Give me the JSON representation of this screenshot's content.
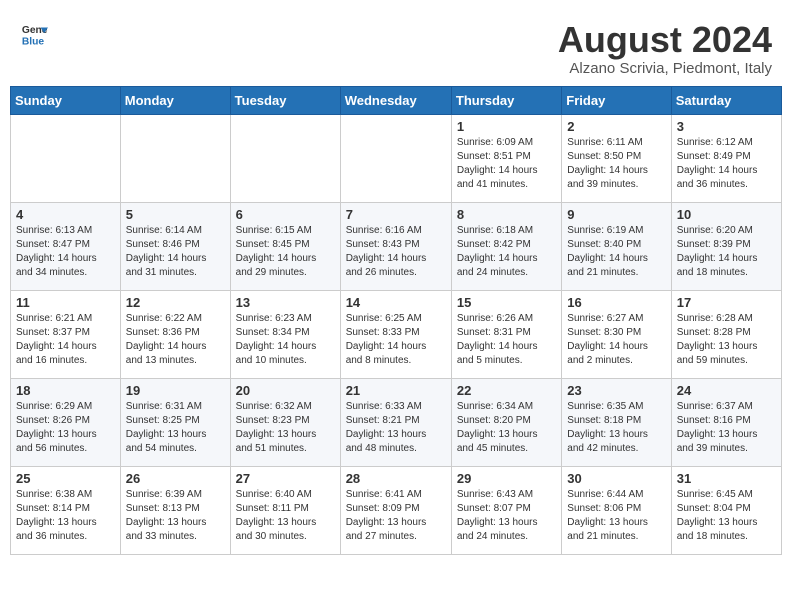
{
  "header": {
    "logo_general": "General",
    "logo_blue": "Blue",
    "month_year": "August 2024",
    "location": "Alzano Scrivia, Piedmont, Italy"
  },
  "weekdays": [
    "Sunday",
    "Monday",
    "Tuesday",
    "Wednesday",
    "Thursday",
    "Friday",
    "Saturday"
  ],
  "weeks": [
    [
      {
        "day": "",
        "info": ""
      },
      {
        "day": "",
        "info": ""
      },
      {
        "day": "",
        "info": ""
      },
      {
        "day": "",
        "info": ""
      },
      {
        "day": "1",
        "info": "Sunrise: 6:09 AM\nSunset: 8:51 PM\nDaylight: 14 hours\nand 41 minutes."
      },
      {
        "day": "2",
        "info": "Sunrise: 6:11 AM\nSunset: 8:50 PM\nDaylight: 14 hours\nand 39 minutes."
      },
      {
        "day": "3",
        "info": "Sunrise: 6:12 AM\nSunset: 8:49 PM\nDaylight: 14 hours\nand 36 minutes."
      }
    ],
    [
      {
        "day": "4",
        "info": "Sunrise: 6:13 AM\nSunset: 8:47 PM\nDaylight: 14 hours\nand 34 minutes."
      },
      {
        "day": "5",
        "info": "Sunrise: 6:14 AM\nSunset: 8:46 PM\nDaylight: 14 hours\nand 31 minutes."
      },
      {
        "day": "6",
        "info": "Sunrise: 6:15 AM\nSunset: 8:45 PM\nDaylight: 14 hours\nand 29 minutes."
      },
      {
        "day": "7",
        "info": "Sunrise: 6:16 AM\nSunset: 8:43 PM\nDaylight: 14 hours\nand 26 minutes."
      },
      {
        "day": "8",
        "info": "Sunrise: 6:18 AM\nSunset: 8:42 PM\nDaylight: 14 hours\nand 24 minutes."
      },
      {
        "day": "9",
        "info": "Sunrise: 6:19 AM\nSunset: 8:40 PM\nDaylight: 14 hours\nand 21 minutes."
      },
      {
        "day": "10",
        "info": "Sunrise: 6:20 AM\nSunset: 8:39 PM\nDaylight: 14 hours\nand 18 minutes."
      }
    ],
    [
      {
        "day": "11",
        "info": "Sunrise: 6:21 AM\nSunset: 8:37 PM\nDaylight: 14 hours\nand 16 minutes."
      },
      {
        "day": "12",
        "info": "Sunrise: 6:22 AM\nSunset: 8:36 PM\nDaylight: 14 hours\nand 13 minutes."
      },
      {
        "day": "13",
        "info": "Sunrise: 6:23 AM\nSunset: 8:34 PM\nDaylight: 14 hours\nand 10 minutes."
      },
      {
        "day": "14",
        "info": "Sunrise: 6:25 AM\nSunset: 8:33 PM\nDaylight: 14 hours\nand 8 minutes."
      },
      {
        "day": "15",
        "info": "Sunrise: 6:26 AM\nSunset: 8:31 PM\nDaylight: 14 hours\nand 5 minutes."
      },
      {
        "day": "16",
        "info": "Sunrise: 6:27 AM\nSunset: 8:30 PM\nDaylight: 14 hours\nand 2 minutes."
      },
      {
        "day": "17",
        "info": "Sunrise: 6:28 AM\nSunset: 8:28 PM\nDaylight: 13 hours\nand 59 minutes."
      }
    ],
    [
      {
        "day": "18",
        "info": "Sunrise: 6:29 AM\nSunset: 8:26 PM\nDaylight: 13 hours\nand 56 minutes."
      },
      {
        "day": "19",
        "info": "Sunrise: 6:31 AM\nSunset: 8:25 PM\nDaylight: 13 hours\nand 54 minutes."
      },
      {
        "day": "20",
        "info": "Sunrise: 6:32 AM\nSunset: 8:23 PM\nDaylight: 13 hours\nand 51 minutes."
      },
      {
        "day": "21",
        "info": "Sunrise: 6:33 AM\nSunset: 8:21 PM\nDaylight: 13 hours\nand 48 minutes."
      },
      {
        "day": "22",
        "info": "Sunrise: 6:34 AM\nSunset: 8:20 PM\nDaylight: 13 hours\nand 45 minutes."
      },
      {
        "day": "23",
        "info": "Sunrise: 6:35 AM\nSunset: 8:18 PM\nDaylight: 13 hours\nand 42 minutes."
      },
      {
        "day": "24",
        "info": "Sunrise: 6:37 AM\nSunset: 8:16 PM\nDaylight: 13 hours\nand 39 minutes."
      }
    ],
    [
      {
        "day": "25",
        "info": "Sunrise: 6:38 AM\nSunset: 8:14 PM\nDaylight: 13 hours\nand 36 minutes."
      },
      {
        "day": "26",
        "info": "Sunrise: 6:39 AM\nSunset: 8:13 PM\nDaylight: 13 hours\nand 33 minutes."
      },
      {
        "day": "27",
        "info": "Sunrise: 6:40 AM\nSunset: 8:11 PM\nDaylight: 13 hours\nand 30 minutes."
      },
      {
        "day": "28",
        "info": "Sunrise: 6:41 AM\nSunset: 8:09 PM\nDaylight: 13 hours\nand 27 minutes."
      },
      {
        "day": "29",
        "info": "Sunrise: 6:43 AM\nSunset: 8:07 PM\nDaylight: 13 hours\nand 24 minutes."
      },
      {
        "day": "30",
        "info": "Sunrise: 6:44 AM\nSunset: 8:06 PM\nDaylight: 13 hours\nand 21 minutes."
      },
      {
        "day": "31",
        "info": "Sunrise: 6:45 AM\nSunset: 8:04 PM\nDaylight: 13 hours\nand 18 minutes."
      }
    ]
  ]
}
